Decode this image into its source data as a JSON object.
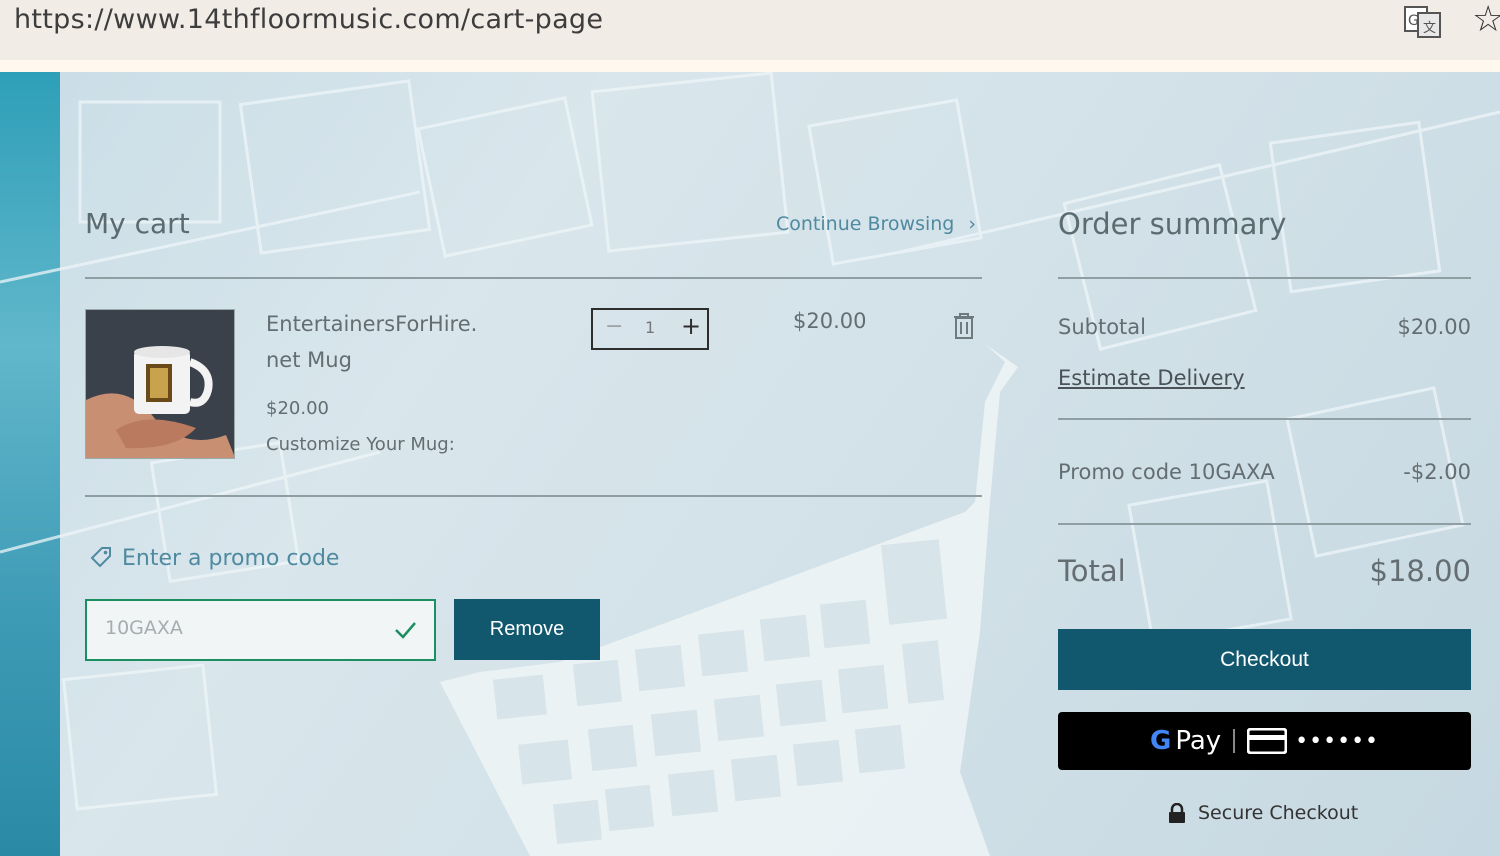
{
  "browser": {
    "url": "https://www.14thfloormusic.com/cart-page",
    "icons": [
      "translate-icon",
      "bookmark-star-icon"
    ]
  },
  "cart": {
    "title": "My cart",
    "continue_label": "Continue Browsing",
    "continue_chevron": "›",
    "item": {
      "name": "EntertainersForHire.net Mug",
      "price": "$20.00",
      "option": "Customize Your Mug:",
      "quantity": "1",
      "qty_minus": "−",
      "qty_plus": "+",
      "line_total": "$20.00"
    },
    "promo": {
      "link_label": "Enter a promo code",
      "value": "10GAXA",
      "remove_label": "Remove"
    }
  },
  "summary": {
    "title": "Order summary",
    "subtotal_label": "Subtotal",
    "subtotal_value": "$20.00",
    "estimate_label": "Estimate Delivery",
    "promo_label": "Promo code 10GAXA",
    "promo_value": "-$2.00",
    "total_label": "Total",
    "total_value": "$18.00",
    "checkout_label": "Checkout",
    "gpay_g": "G",
    "gpay_label": "Pay",
    "gpay_card_dots": "••••••",
    "secure_label": "Secure Checkout"
  },
  "colors": {
    "accent": "#11576e",
    "link": "#4f8aa0",
    "promo_valid": "#1c8f62"
  }
}
